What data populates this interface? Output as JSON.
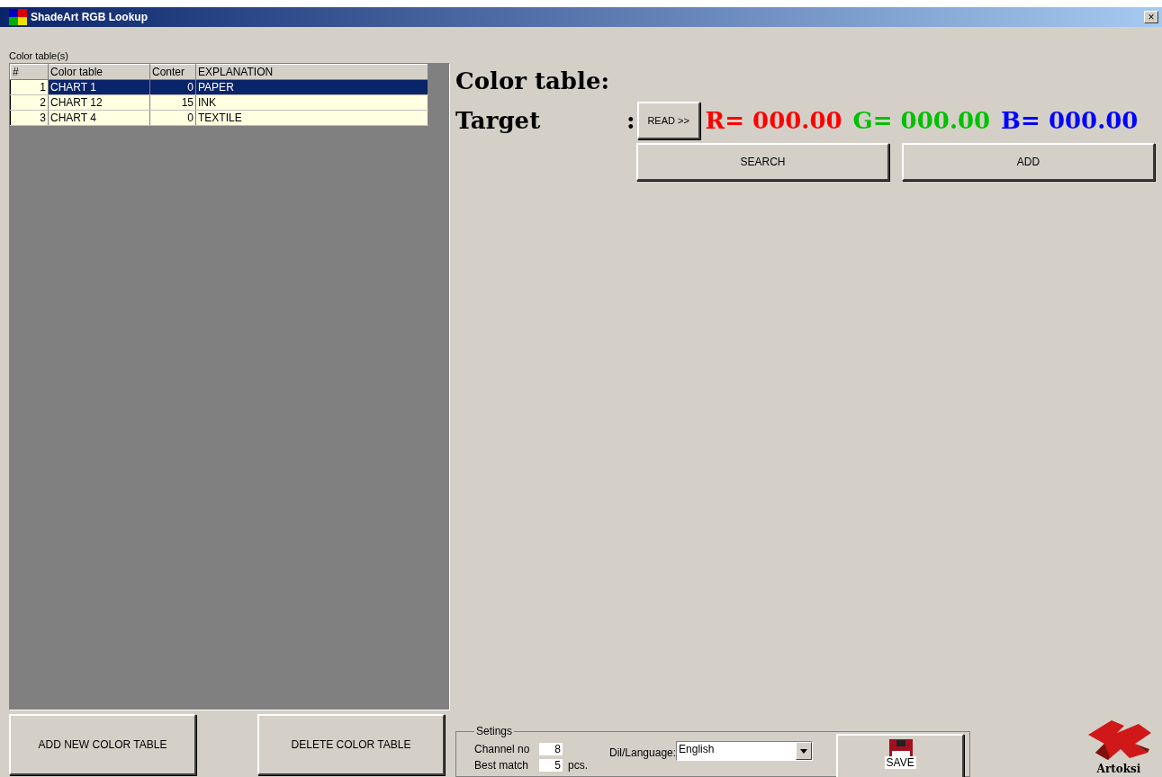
{
  "window": {
    "title": "ShadeArt RGB Lookup",
    "close": "×"
  },
  "tables_panel": {
    "label": "Color table(s)",
    "columns": [
      "#",
      "Color table",
      "Conter",
      "EXPLANATION"
    ],
    "rows": [
      {
        "cells": [
          "1",
          "CHART 1",
          "0",
          "PAPER"
        ],
        "selected": true
      },
      {
        "cells": [
          "2",
          "CHART 12",
          "15",
          "INK"
        ],
        "selected": false
      },
      {
        "cells": [
          "3",
          "CHART 4",
          "0",
          "TEXTILE"
        ],
        "selected": false
      }
    ],
    "buttons": [
      "ADD NEW COLOR TABLE",
      "DELETE COLOR TABLE"
    ]
  },
  "detail": {
    "heading": "Color table:",
    "target_label": "Target",
    "colon": ":",
    "read_button": "READ >>",
    "readings": [
      {
        "text": "R= 000.00",
        "color": "#ff0000"
      },
      {
        "text": "G= 000.00",
        "color": "#00c000"
      },
      {
        "text": "B= 000.00",
        "color": "#0000ff"
      }
    ],
    "buttons": [
      "SEARCH",
      "ADD"
    ]
  },
  "settings": {
    "title": "Setings",
    "fields": [
      {
        "label": "Channel no",
        "value": "8"
      },
      {
        "label": "Best match",
        "value": "5",
        "unit": "pcs."
      }
    ],
    "language_label": "Dil/Language:",
    "language": "English",
    "save_button": "SAVE"
  },
  "logo": {
    "text": "Artoksi"
  }
}
